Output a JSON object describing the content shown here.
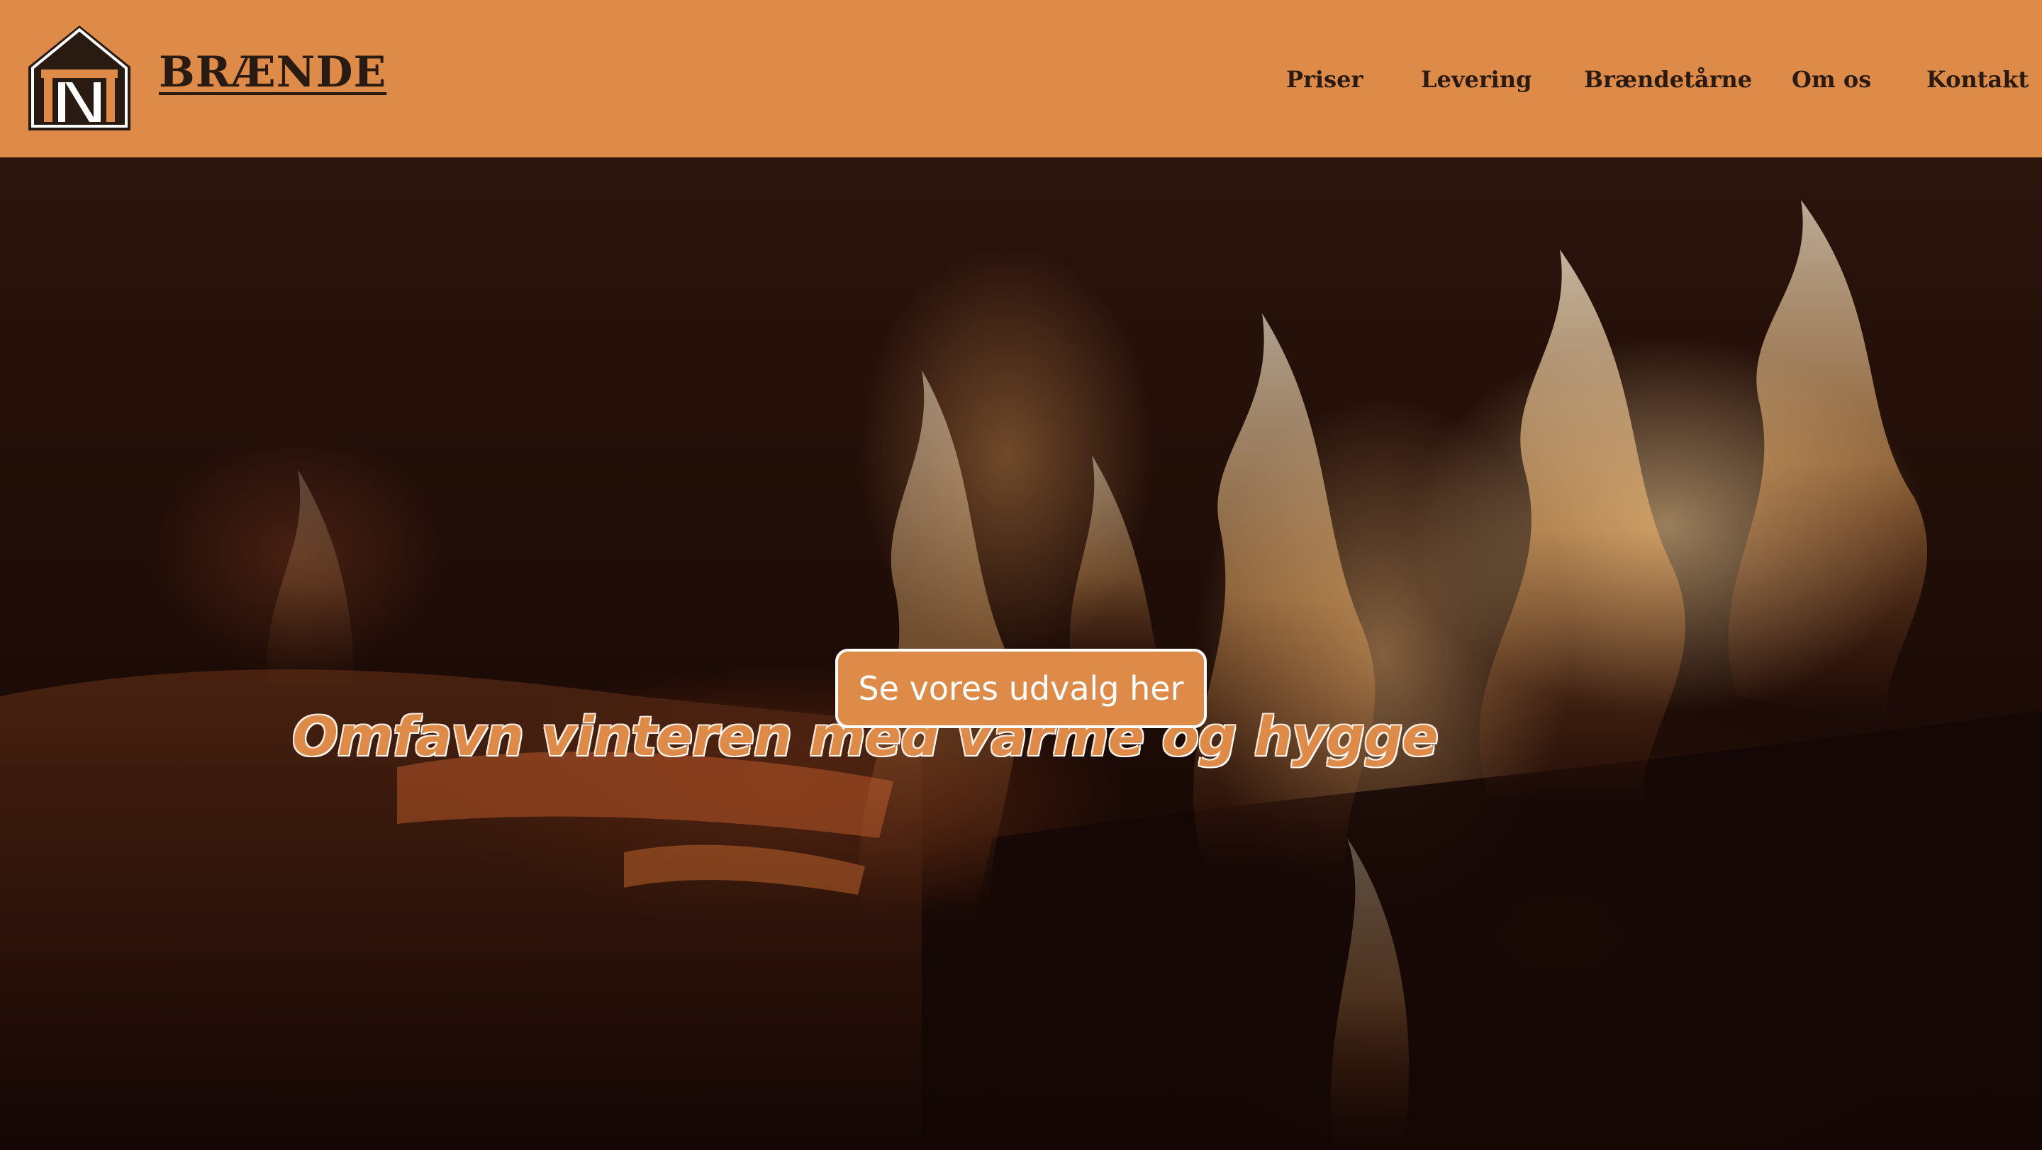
{
  "header": {
    "brand": "BRÆNDE",
    "logo_icon": "woodshed-logo-icon",
    "nav": [
      {
        "label": "Priser"
      },
      {
        "label": "Levering"
      },
      {
        "label": "Brændetårne"
      },
      {
        "label": "Om os"
      },
      {
        "label": "Kontakt"
      }
    ]
  },
  "hero": {
    "background": "fireplace-flames-image",
    "headline": "Omfavn vinteren med varme og hygge",
    "cta_label": "Se vores udvalg her"
  },
  "colors": {
    "accent": "#DE8B4A",
    "text_dark": "#2a1b12",
    "white": "#ffffff"
  }
}
